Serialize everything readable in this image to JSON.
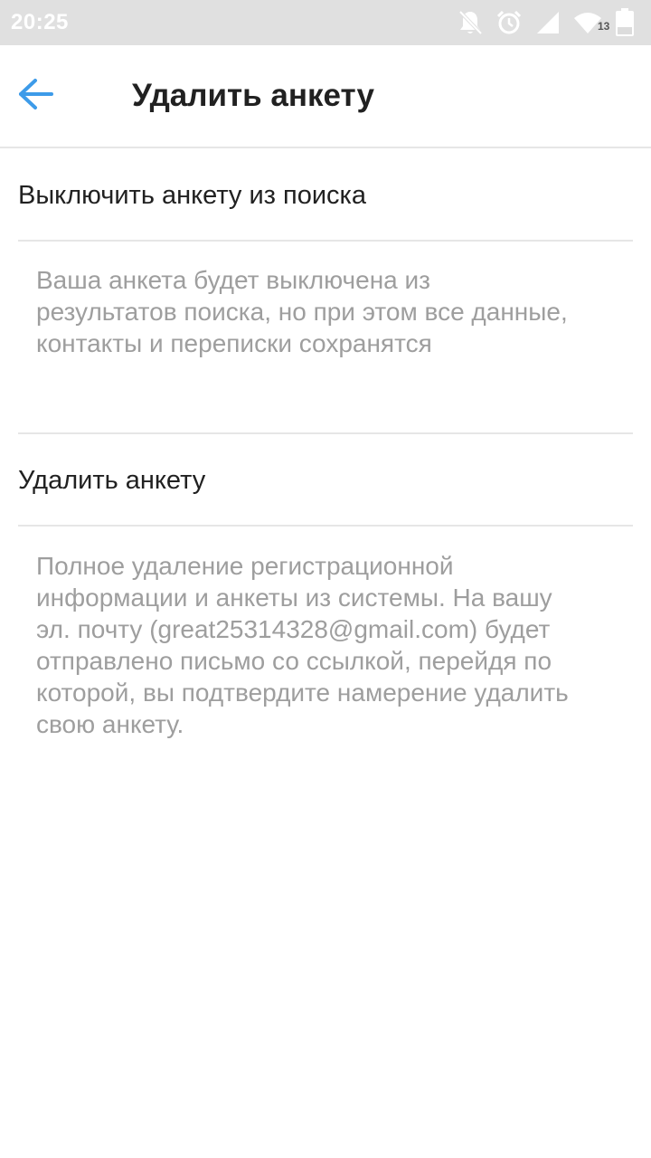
{
  "status_bar": {
    "time": "20:25",
    "battery_level": "13",
    "icons": [
      "bell-off-icon",
      "alarm-icon",
      "signal-icon",
      "wifi-icon",
      "battery-icon"
    ]
  },
  "app_bar": {
    "title": "Удалить анкету",
    "back_icon": "arrow-back-icon"
  },
  "colors": {
    "accent": "#3d9be9",
    "primary_text": "#212121",
    "secondary_text": "#9e9e9e",
    "divider": "#e6e6e6",
    "status_bar": "#e0e0e0"
  },
  "options": [
    {
      "label": "Выключить анкету из поиска",
      "description_lines": [
        "Ваша анкета будет выключена из",
        "результатов поиска, но при этом все данные,",
        "контакты и переписки сохранятся"
      ]
    },
    {
      "label": "Удалить анкету",
      "description_lines": [
        "Полное удаление регистрационной",
        "информации и анкеты из системы. На вашу",
        "эл. почту (great25314328@gmail.com) будет",
        "отправлено письмо со ссылкой, перейдя по",
        "которой, вы подтвердите намерение удалить",
        "свою анкету."
      ]
    }
  ]
}
